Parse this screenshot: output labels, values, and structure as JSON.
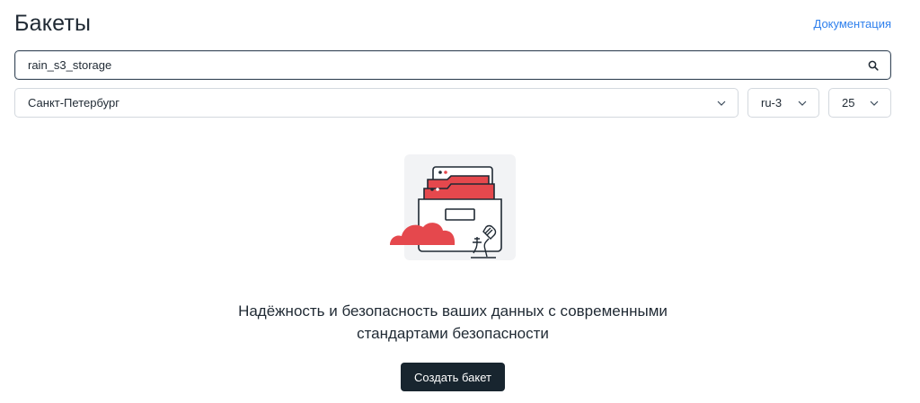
{
  "header": {
    "title": "Бакеты",
    "docs_link": "Документация"
  },
  "search": {
    "value": "rain_s3_storage",
    "icon": "search-icon"
  },
  "filters": {
    "city": {
      "selected": "Санкт-Петербург"
    },
    "zone": {
      "selected": "ru-3"
    },
    "page_size": {
      "selected": "25"
    }
  },
  "empty_state": {
    "illustration": "storage-box-illustration",
    "line1": "Надёжность и безопасность ваших данных с современными",
    "line2": "стандартами безопасности",
    "button_label": "Создать бакет"
  },
  "colors": {
    "accent_red": "#e5484d",
    "button_dark": "#18252f",
    "link_blue": "#2f80ed"
  }
}
